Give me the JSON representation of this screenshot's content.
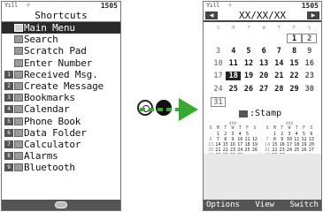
{
  "left_screen": {
    "status": {
      "signal": "Yıll",
      "clock": "15:05",
      "clock_display": "1505"
    },
    "title": "Shortcuts",
    "menu": [
      {
        "label": "Main Menu",
        "icon": "menu-icon",
        "number": ""
      },
      {
        "label": "Search",
        "icon": "search-icon",
        "number": ""
      },
      {
        "label": "Scratch Pad",
        "icon": "notepad-icon",
        "number": ""
      },
      {
        "label": "Enter Number",
        "icon": "keypad-icon",
        "number": ""
      },
      {
        "label": "Received Msg.",
        "icon": "mail-icon",
        "number": "1"
      },
      {
        "label": "Create Message",
        "icon": "compose-icon",
        "number": "2"
      },
      {
        "label": "Bookmarks",
        "icon": "bookmark-icon",
        "number": "3"
      },
      {
        "label": "Calendar",
        "icon": "calendar-icon",
        "number": "4"
      },
      {
        "label": "Phone Book",
        "icon": "phonebook-icon",
        "number": "5"
      },
      {
        "label": "Data Folder",
        "icon": "folder-icon",
        "number": "6"
      },
      {
        "label": "Calculator",
        "icon": "calculator-icon",
        "number": "7"
      },
      {
        "label": "Alarms",
        "icon": "alarm-icon",
        "number": "8"
      },
      {
        "label": "Bluetooth",
        "icon": "bluetooth-icon",
        "number": "9"
      }
    ],
    "selected_index": 0
  },
  "right_screen": {
    "status": {
      "signal": "Yıll",
      "clock_display": "1505"
    },
    "date": "XX/XX/XX",
    "weekdays": [
      "S",
      "M",
      "T",
      "W",
      "T",
      "F",
      "S"
    ],
    "weeks": [
      [
        "",
        "",
        "",
        "",
        "",
        "1",
        "2"
      ],
      [
        "3",
        "4",
        "5",
        "6",
        "7",
        "8",
        "9"
      ],
      [
        "10",
        "11",
        "12",
        "13",
        "14",
        "15",
        "16"
      ],
      [
        "17",
        "18",
        "19",
        "20",
        "21",
        "22",
        "23"
      ],
      [
        "24",
        "25",
        "26",
        "27",
        "28",
        "29",
        "30"
      ],
      [
        "31",
        "",
        "",
        "",
        "",
        "",
        ""
      ]
    ],
    "selected_day": "18",
    "stamp_label": ":Stamp",
    "mini_calendars": [
      {
        "title": "XXX",
        "header": [
          "S",
          "M",
          "T",
          "W",
          "T",
          "F",
          "S"
        ],
        "days": [
          "",
          "1",
          "2",
          "3",
          "4",
          "5",
          "",
          "6",
          "7",
          "8",
          "9",
          "10",
          "11",
          "12",
          "13",
          "14",
          "15",
          "16",
          "17",
          "18",
          "19",
          "20",
          "21",
          "22",
          "23",
          "24",
          "25",
          "26",
          "27",
          "28",
          "29",
          "30",
          "31",
          "",
          "",
          ""
        ]
      },
      {
        "title": "XXX",
        "header": [
          "S",
          "M",
          "T",
          "W",
          "T",
          "F",
          "S"
        ],
        "days": [
          "",
          "1",
          "2",
          "3",
          "4",
          "5",
          "6",
          "7",
          "8",
          "9",
          "10",
          "11",
          "12",
          "13",
          "14",
          "15",
          "16",
          "17",
          "18",
          "19",
          "20",
          "21",
          "22",
          "23",
          "24",
          "25",
          "26",
          "27",
          "28",
          "29",
          "30",
          "",
          "",
          "",
          "",
          ""
        ]
      }
    ],
    "softkeys": {
      "left": "Options",
      "center": "View",
      "right": "Switch"
    }
  },
  "transition": {
    "keys": [
      "nav-key",
      "ok-key"
    ],
    "arrow_color": "#3aa833"
  }
}
